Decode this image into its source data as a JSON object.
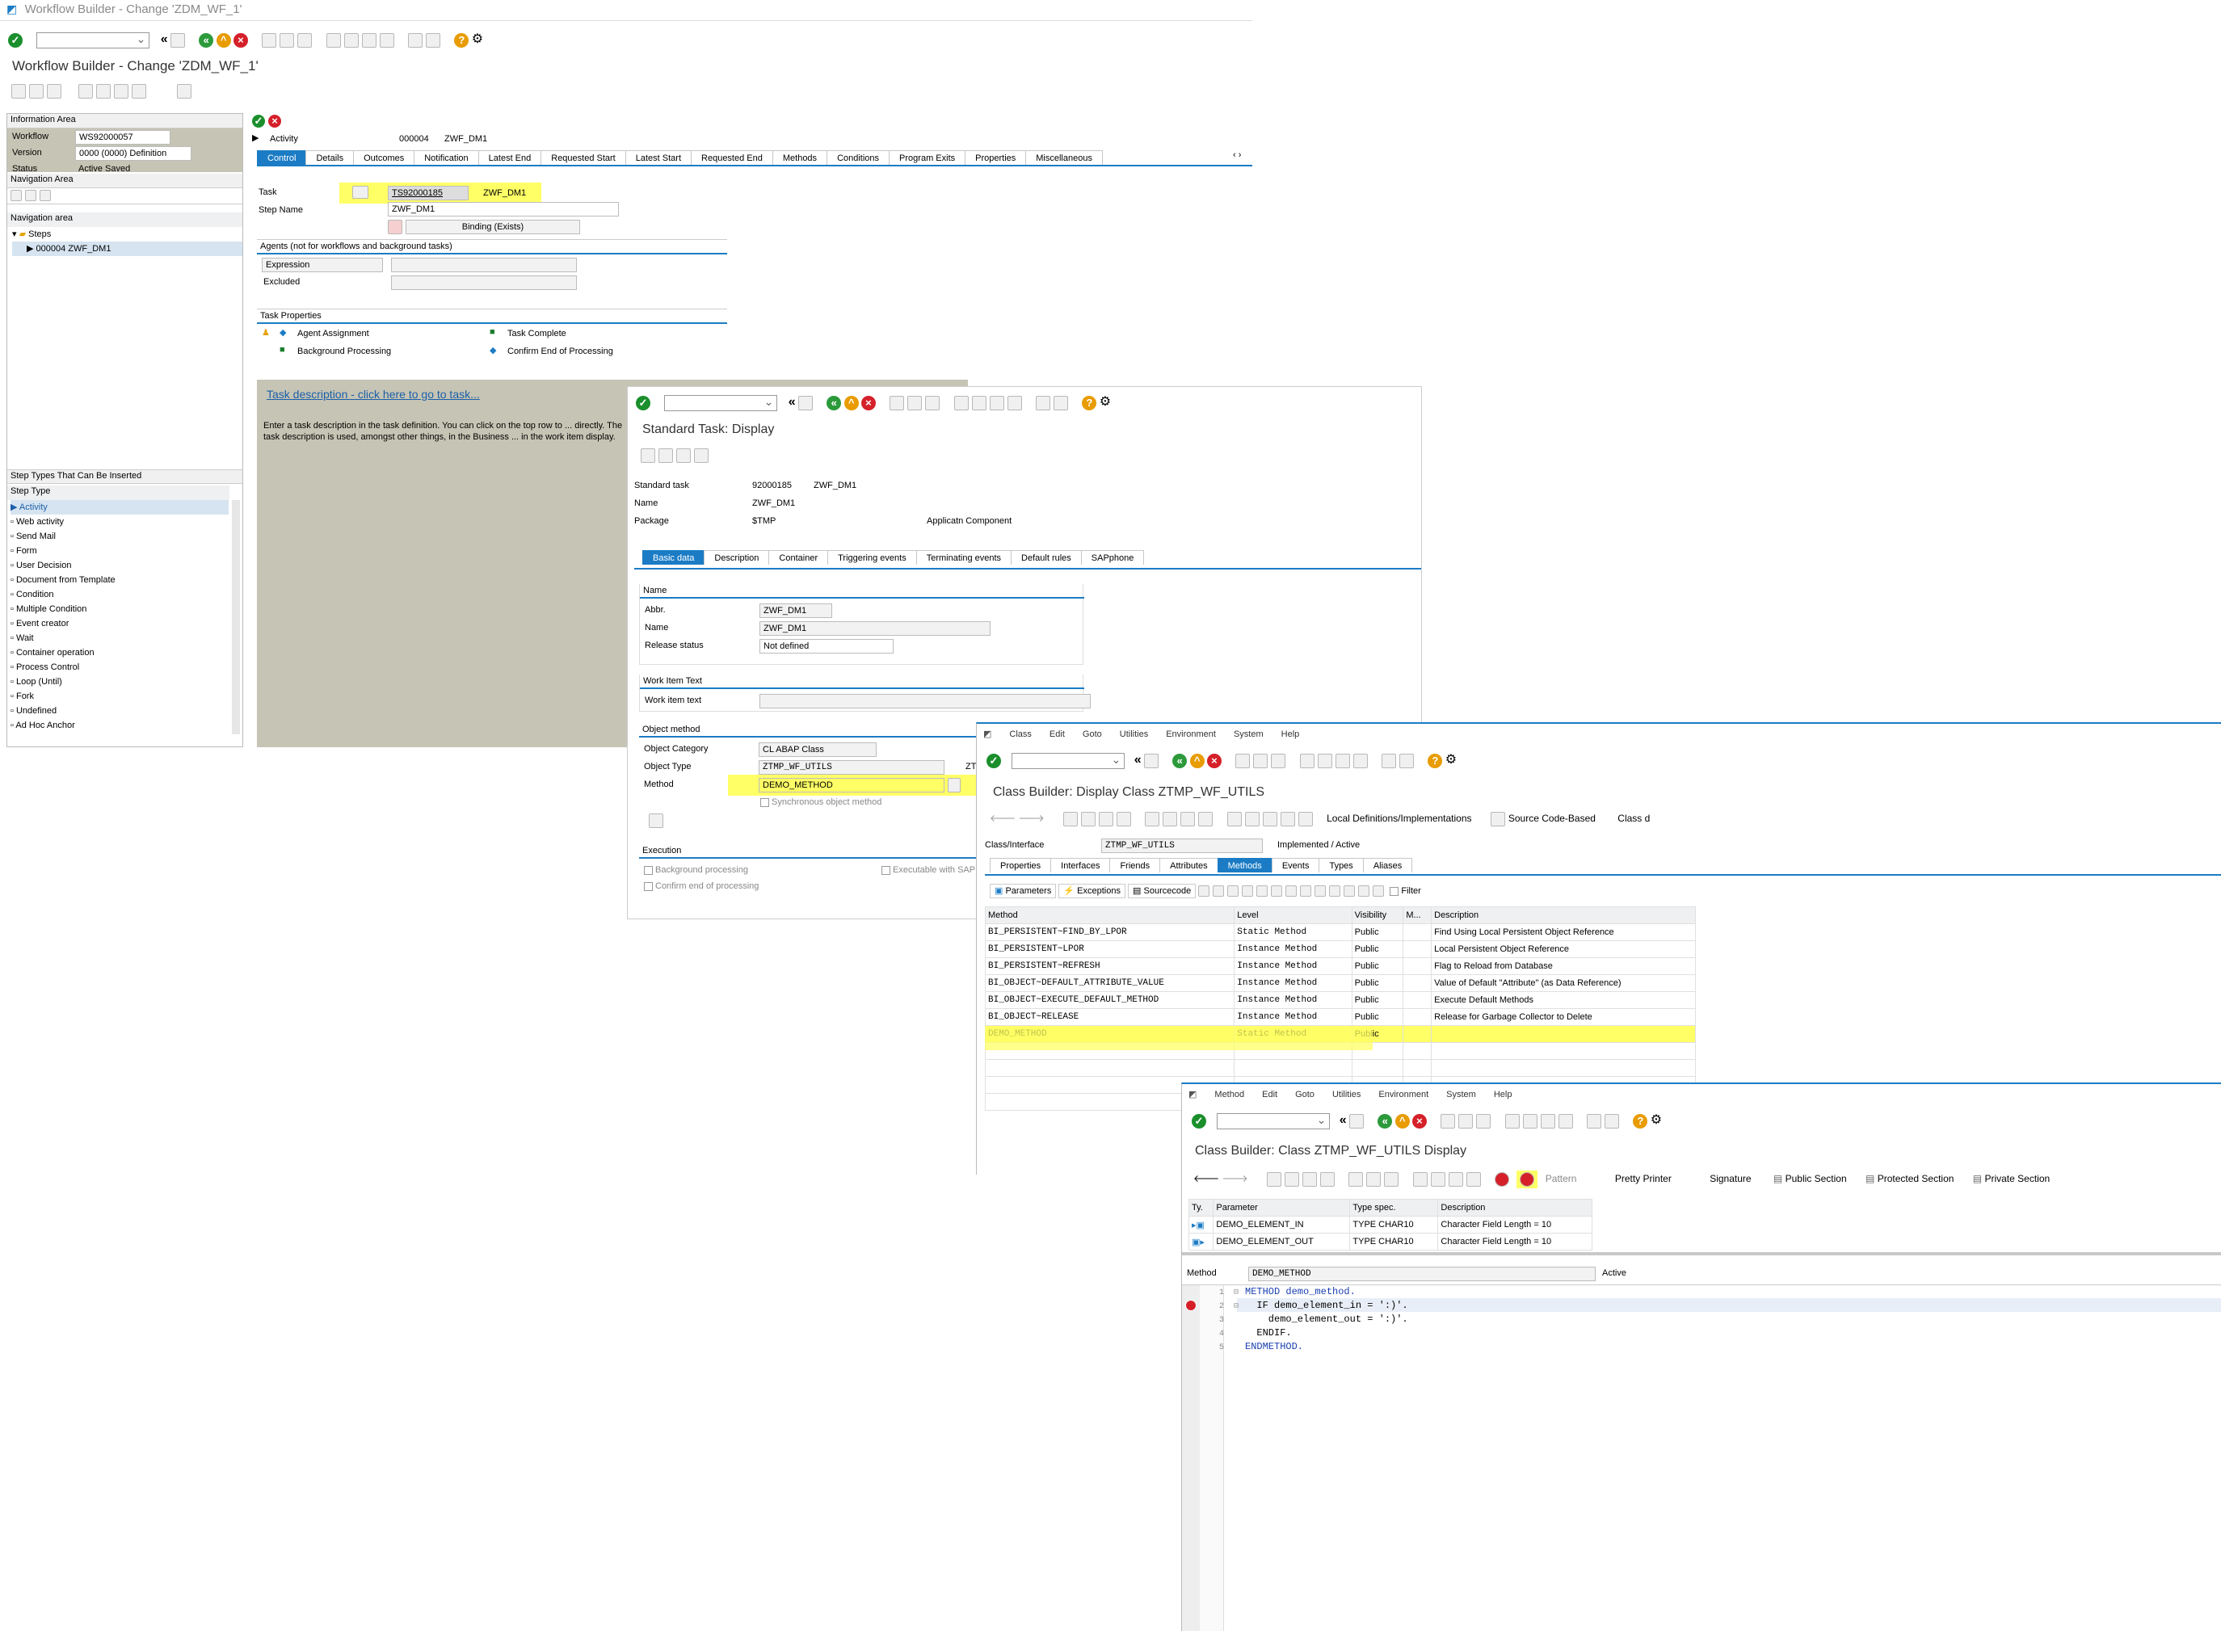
{
  "w1": {
    "titlebar": "Workflow Builder - Change 'ZDM_WF_1'",
    "title": "Workflow Builder - Change 'ZDM_WF_1'",
    "info_area_label": "Information Area",
    "workflow_label": "Workflow",
    "workflow_value": "WS92000057",
    "version_label": "Version",
    "version_value": "0000 (0000) Definition",
    "status_label": "Status",
    "status_value": "Active Saved",
    "nav_area_label": "Navigation Area",
    "nav_area_tree_label": "Navigation area",
    "tree_steps": "Steps",
    "tree_step1": "000004 ZWF_DM1",
    "step_types_label": "Step Types That Can Be Inserted",
    "step_type_header": "Step Type",
    "step_types": [
      "Activity",
      "Web activity",
      "Send Mail",
      "Form",
      "User Decision",
      "Document from Template",
      "Condition",
      "Multiple Condition",
      "Event creator",
      "Wait",
      "Container operation",
      "Process Control",
      "Loop (Until)",
      "Fork",
      "Undefined",
      "Ad Hoc Anchor"
    ],
    "activity_label": "Activity",
    "activity_num": "000004",
    "activity_name": "ZWF_DM1",
    "tabs": [
      "Control",
      "Details",
      "Outcomes",
      "Notification",
      "Latest End",
      "Requested Start",
      "Latest Start",
      "Requested End",
      "Methods",
      "Conditions",
      "Program Exits",
      "Properties",
      "Miscellaneous"
    ],
    "task_label": "Task",
    "task_value": "TS92000185",
    "task_name": "ZWF_DM1",
    "step_name_label": "Step Name",
    "step_name_value": "ZWF_DM1",
    "binding": "Binding (Exists)",
    "agents_header": "Agents (not for workflows and background tasks)",
    "expression": "Expression",
    "excluded": "Excluded",
    "task_props_header": "Task Properties",
    "agent_assignment": "Agent Assignment",
    "task_complete": "Task Complete",
    "background_processing": "Background Processing",
    "confirm_end": "Confirm End of Processing",
    "task_desc_link": "Task description - click here to go to task...",
    "task_desc_text": "Enter a task description in the task definition. You can click on the top row to ... directly. The task description is used, amongst other things, in the Business ... in the work item display."
  },
  "w2": {
    "title": "Standard Task: Display",
    "std_task_label": "Standard task",
    "std_task_value": "92000185",
    "std_task_name": "ZWF_DM1",
    "name_label": "Name",
    "name_value": "ZWF_DM1",
    "package_label": "Package",
    "package_value": "$TMP",
    "app_comp_label": "Applicatn Component",
    "tabs": [
      "Basic data",
      "Description",
      "Container",
      "Triggering events",
      "Terminating events",
      "Default rules",
      "SAPphone"
    ],
    "name_group": "Name",
    "abbr_label": "Abbr.",
    "abbr_value": "ZWF_DM1",
    "name2_label": "Name",
    "name2_value": "ZWF_DM1",
    "release_label": "Release status",
    "release_value": "Not defined",
    "wit_group": "Work Item Text",
    "wit_label": "Work item text",
    "obj_method_group": "Object method",
    "obj_cat_label": "Object Category",
    "obj_cat_value": "CL ABAP Class",
    "obj_type_label": "Object Type",
    "obj_type_value": "ZTMP_WF_UTILS",
    "obj_type_short": "ZTM",
    "method_label": "Method",
    "method_value": "DEMO_METHOD",
    "sync_label": "Synchronous object method",
    "exec_group": "Execution",
    "bg_proc": "Background processing",
    "exec_sap": "Executable with SAP",
    "confirm_end": "Confirm end of processing"
  },
  "w3": {
    "menu": [
      "Class",
      "Edit",
      "Goto",
      "Utilities",
      "Environment",
      "System",
      "Help"
    ],
    "title": "Class Builder: Display Class ZTMP_WF_UTILS",
    "local_defs": "Local Definitions/Implementations",
    "source_based": "Source Code-Based",
    "class_trunc": "Class d",
    "class_label": "Class/Interface",
    "class_value": "ZTMP_WF_UTILS",
    "class_status": "Implemented / Active",
    "tabs": [
      "Properties",
      "Interfaces",
      "Friends",
      "Attributes",
      "Methods",
      "Events",
      "Types",
      "Aliases"
    ],
    "subtabs": [
      "Parameters",
      "Exceptions",
      "Sourcecode"
    ],
    "filter": "Filter",
    "columns": [
      "Method",
      "Level",
      "Visibility",
      "M...",
      "Description"
    ],
    "rows": [
      [
        "BI_PERSISTENT~FIND_BY_LPOR",
        "Static Method",
        "Public",
        "",
        "Find Using Local Persistent Object Reference"
      ],
      [
        "BI_PERSISTENT~LPOR",
        "Instance Method",
        "Public",
        "",
        "Local Persistent Object Reference"
      ],
      [
        "BI_PERSISTENT~REFRESH",
        "Instance Method",
        "Public",
        "",
        "Flag to Reload from Database"
      ],
      [
        "BI_OBJECT~DEFAULT_ATTRIBUTE_VALUE",
        "Instance Method",
        "Public",
        "",
        "Value of Default \"Attribute\" (as Data Reference)"
      ],
      [
        "BI_OBJECT~EXECUTE_DEFAULT_METHOD",
        "Instance Method",
        "Public",
        "",
        "Execute Default Methods"
      ],
      [
        "BI_OBJECT~RELEASE",
        "Instance Method",
        "Public",
        "",
        "Release for Garbage Collector to Delete"
      ],
      [
        "DEMO_METHOD",
        "Static Method",
        "Public",
        "",
        ""
      ]
    ]
  },
  "w4": {
    "menu": [
      "Method",
      "Edit",
      "Goto",
      "Utilities",
      "Environment",
      "System",
      "Help"
    ],
    "title": "Class Builder: Class ZTMP_WF_UTILS Display",
    "toolbar_text": [
      "Pattern",
      "Pretty Printer",
      "Signature",
      "Public Section",
      "Protected Section",
      "Private Section"
    ],
    "param_cols": [
      "Ty.",
      "Parameter",
      "Type spec.",
      "Description"
    ],
    "params": [
      [
        "DEMO_ELEMENT_IN",
        "TYPE CHAR10",
        "Character Field Length = 10"
      ],
      [
        "DEMO_ELEMENT_OUT",
        "TYPE CHAR10",
        "Character Field Length = 10"
      ]
    ],
    "method_label": "Method",
    "method_value": "DEMO_METHOD",
    "method_status": "Active",
    "code": [
      {
        "n": "1",
        "text": "METHOD demo_method."
      },
      {
        "n": "2",
        "text": "  IF demo_element_in = ':)'."
      },
      {
        "n": "3",
        "text": "    demo_element_out = ':)'."
      },
      {
        "n": "4",
        "text": "  ENDIF."
      },
      {
        "n": "5",
        "text": "ENDMETHOD."
      }
    ]
  },
  "colors": {
    "accent": "#1b7cc5",
    "highlight": "#ffff66",
    "panel": "#c6c4b4"
  }
}
